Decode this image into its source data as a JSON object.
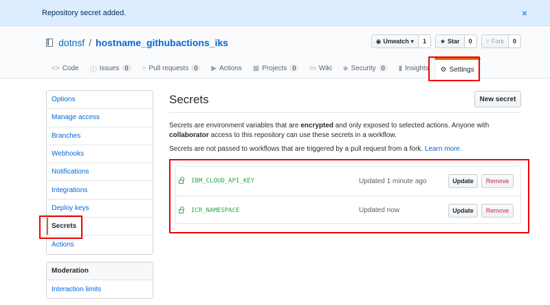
{
  "flash": {
    "message": "Repository secret added.",
    "close": "×"
  },
  "repo": {
    "owner": "dotnsf",
    "separator": "/",
    "name": "hostname_githubactions_iks"
  },
  "buttons": {
    "watch": {
      "label": "Unwatch ▾",
      "count": "1"
    },
    "star": {
      "label": "Star",
      "count": "0"
    },
    "fork": {
      "label": "Fork",
      "count": "0"
    }
  },
  "tabs": [
    {
      "label": "Code",
      "icon": "<>"
    },
    {
      "label": "Issues",
      "icon": "ⓘ",
      "counter": "0"
    },
    {
      "label": "Pull requests",
      "icon": "⑂",
      "counter": "0"
    },
    {
      "label": "Actions",
      "icon": "▶"
    },
    {
      "label": "Projects",
      "icon": "▦",
      "counter": "0"
    },
    {
      "label": "Wiki",
      "icon": "▭"
    },
    {
      "label": "Security",
      "icon": "◈",
      "counter": "0"
    },
    {
      "label": "Insights",
      "icon": "▮"
    },
    {
      "label": "Settings",
      "icon": "⚙"
    }
  ],
  "sidebar": {
    "items": [
      "Options",
      "Manage access",
      "Branches",
      "Webhooks",
      "Notifications",
      "Integrations",
      "Deploy keys",
      "Secrets",
      "Actions"
    ],
    "moderation_header": "Moderation",
    "moderation_items": [
      "Interaction limits"
    ]
  },
  "main": {
    "title": "Secrets",
    "new_secret_button": "New secret",
    "desc1_a": "Secrets are environment variables that are ",
    "desc1_b": "encrypted",
    "desc1_c": " and only exposed to selected actions. Anyone with ",
    "desc1_d": "collaborator",
    "desc1_e": " access to this repository can use these secrets in a workflow.",
    "desc2": "Secrets are not passed to workflows that are triggered by a pull request from a fork. ",
    "learn_more": "Learn more.",
    "secrets": [
      {
        "name": "IBM_CLOUD_API_KEY",
        "updated": "Updated 1 minute ago",
        "update_label": "Update",
        "remove_label": "Remove"
      },
      {
        "name": "ICR_NAMESPACE",
        "updated": "Updated now",
        "update_label": "Update",
        "remove_label": "Remove"
      }
    ]
  },
  "colors": {
    "accent": "#0366d6",
    "highlight": "#e00000",
    "secret_green": "#28a745",
    "tab_active": "#e36209"
  }
}
